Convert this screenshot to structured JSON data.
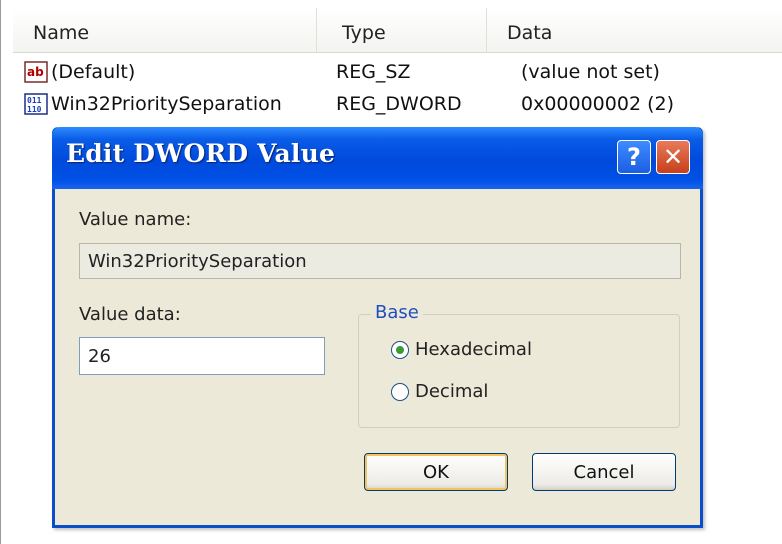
{
  "list": {
    "columns": {
      "name": "Name",
      "type": "Type",
      "data": "Data"
    },
    "rows": [
      {
        "icon": "string-value-icon",
        "name": "(Default)",
        "type": "REG_SZ",
        "data": "(value not set)"
      },
      {
        "icon": "binary-value-icon",
        "name": "Win32PrioritySeparation",
        "type": "REG_DWORD",
        "data": "0x00000002 (2)"
      }
    ]
  },
  "dialog": {
    "title": "Edit DWORD Value",
    "help_glyph": "?",
    "close_glyph": "✕",
    "value_name_label": "Value name:",
    "value_name": "Win32PrioritySeparation",
    "value_data_label": "Value data:",
    "value_data": "26",
    "base_label": "Base",
    "base_options": [
      {
        "label": "Hexadecimal",
        "selected": true
      },
      {
        "label": "Decimal",
        "selected": false
      }
    ],
    "ok_label": "OK",
    "cancel_label": "Cancel"
  },
  "colors": {
    "titlebar_blue": "#0049dc",
    "dialog_bg": "#ece9d8",
    "group_title": "#1f4fbf"
  }
}
